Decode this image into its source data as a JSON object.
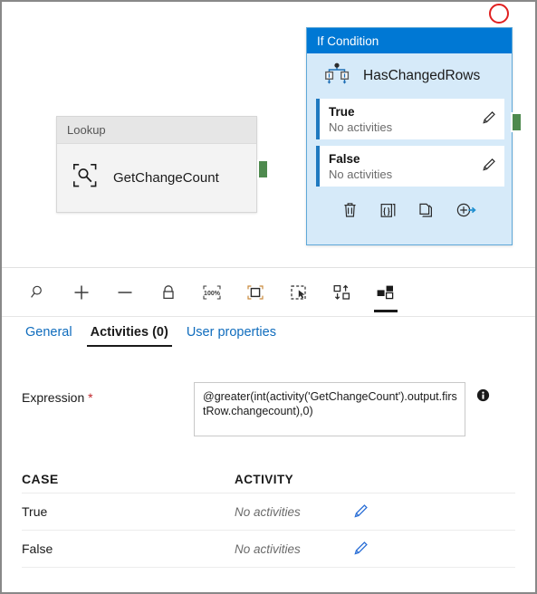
{
  "canvas": {
    "lookup_node": {
      "type_label": "Lookup",
      "name": "GetChangeCount",
      "icon": "lookup-magnifier-icon",
      "output_connector": "green-output-connector"
    },
    "if_node": {
      "type_label": "If Condition",
      "name": "HasChangedRows",
      "icon": "branch-condition-icon",
      "branches": [
        {
          "name": "True",
          "activities": "No activities",
          "edit_icon": "pencil-icon"
        },
        {
          "name": "False",
          "activities": "No activities",
          "edit_icon": "pencil-icon"
        }
      ],
      "actions": [
        {
          "name": "delete-icon"
        },
        {
          "name": "code-braces-icon"
        },
        {
          "name": "copy-icon"
        },
        {
          "name": "add-output-icon"
        }
      ],
      "output_connector": "green-output-connector"
    },
    "annotation": {
      "name": "red-highlight-circle",
      "color": "#e02020"
    }
  },
  "toolbar": {
    "buttons": [
      {
        "name": "zoom-search-icon",
        "active": false
      },
      {
        "name": "zoom-in-icon",
        "active": false
      },
      {
        "name": "zoom-out-icon",
        "active": false
      },
      {
        "name": "lock-icon",
        "active": false
      },
      {
        "name": "zoom-100-percent-icon",
        "label": "100%",
        "active": false
      },
      {
        "name": "zoom-to-fit-icon",
        "active": false
      },
      {
        "name": "select-marquee-icon",
        "active": false
      },
      {
        "name": "auto-align-icon",
        "active": false
      },
      {
        "name": "layout-nodes-icon",
        "active": true
      }
    ]
  },
  "tabs": [
    {
      "label": "General",
      "active": false
    },
    {
      "label": "Activities (0)",
      "active": true
    },
    {
      "label": "User properties",
      "active": false
    }
  ],
  "form": {
    "expression_label": "Expression",
    "required_marker": "*",
    "expression_value": "@greater(int(activity('GetChangeCount').output.firstRow.changecount),0)",
    "info_icon": "info-icon"
  },
  "table": {
    "headers": {
      "case": "CASE",
      "activity": "ACTIVITY"
    },
    "rows": [
      {
        "case": "True",
        "activity": "No activities",
        "edit_icon": "pencil-icon"
      },
      {
        "case": "False",
        "activity": "No activities",
        "edit_icon": "pencil-icon"
      }
    ]
  },
  "colors": {
    "accent_blue": "#0078d4",
    "link_blue": "#0f6cbd",
    "node_fill": "#d6eaf9",
    "connector_green": "#4e8a4e",
    "annotation_red": "#e02020"
  }
}
